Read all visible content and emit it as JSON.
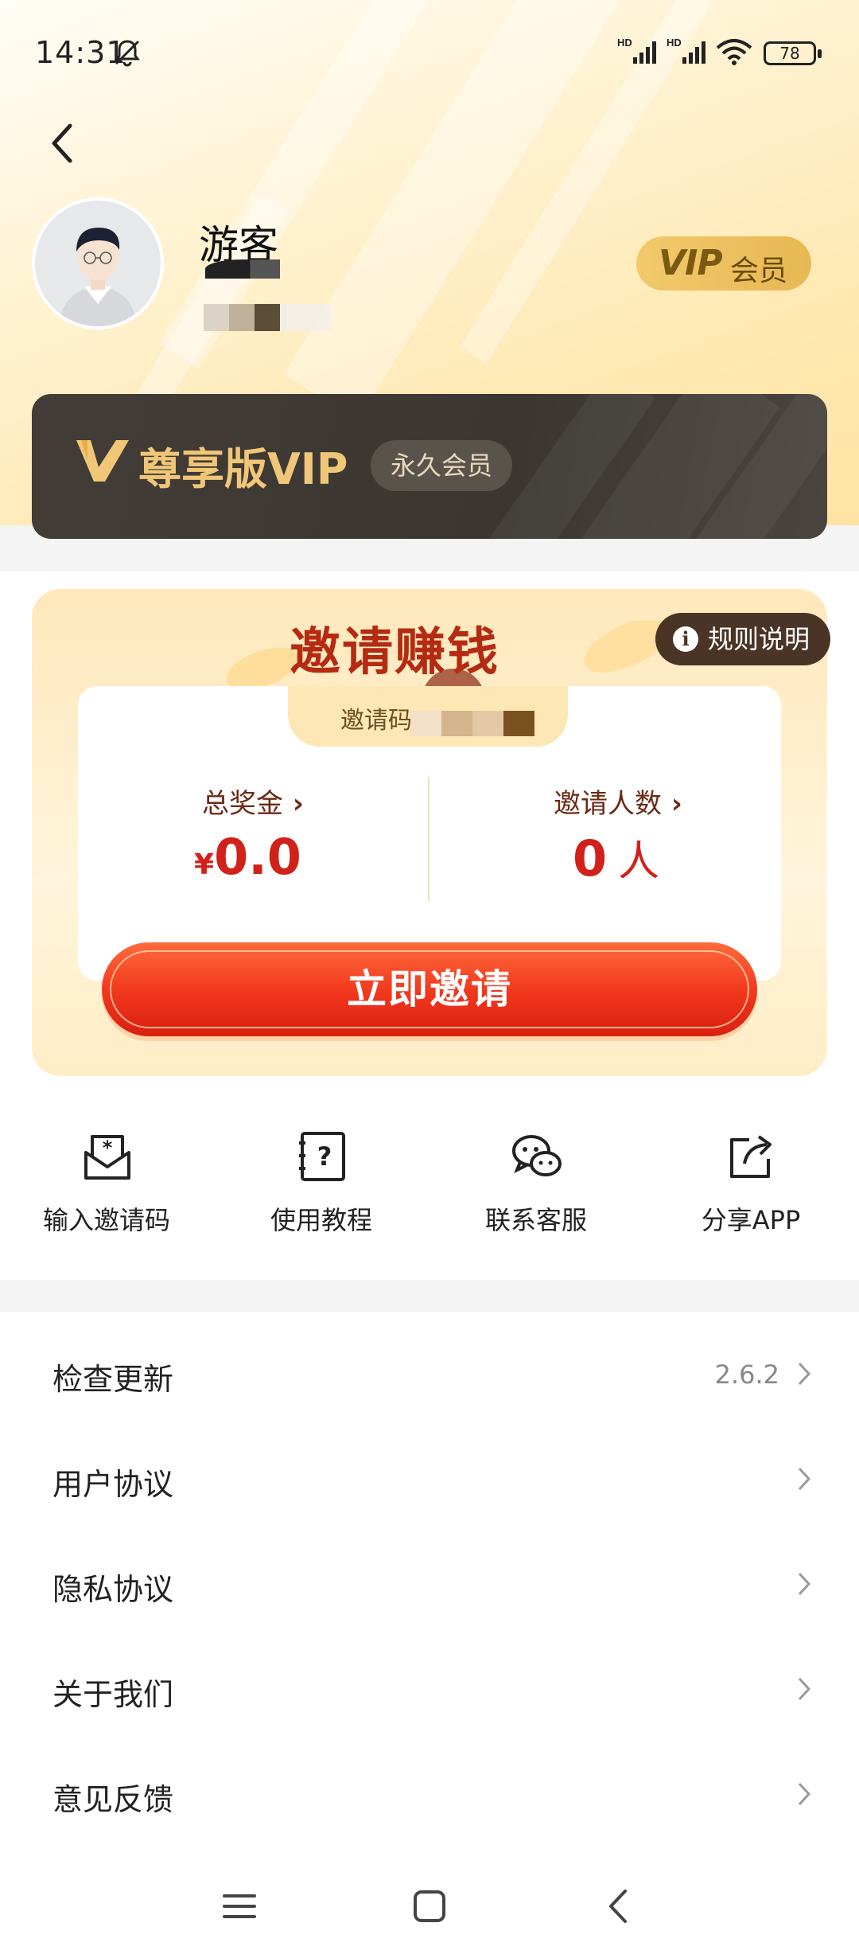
{
  "status_bar": {
    "time": "14:31",
    "signal1": "HD",
    "signal2": "HD",
    "battery": "78"
  },
  "profile": {
    "username": "游客",
    "vip_badge_logo": "VIP",
    "vip_badge_text": "会员"
  },
  "vip_card": {
    "title": "尊享版VIP",
    "pill": "永久会员"
  },
  "invite": {
    "title": "邀请赚钱",
    "rules_label": "规则说明",
    "code_label": "邀请码",
    "total_bonus_label": "总奖金",
    "currency": "¥",
    "total_bonus_value": "0.0",
    "invitee_label": "邀请人数",
    "invitee_value": "0",
    "invitee_unit": "人",
    "button_label": "立即邀请"
  },
  "quick_actions": [
    {
      "label": "输入邀请码",
      "icon": "mail-star-icon"
    },
    {
      "label": "使用教程",
      "icon": "question-book-icon"
    },
    {
      "label": "联系客服",
      "icon": "wechat-icon"
    },
    {
      "label": "分享APP",
      "icon": "share-icon"
    }
  ],
  "menu": [
    {
      "label": "检查更新",
      "value": "2.6.2"
    },
    {
      "label": "用户协议",
      "value": ""
    },
    {
      "label": "隐私协议",
      "value": ""
    },
    {
      "label": "关于我们",
      "value": ""
    },
    {
      "label": "意见反馈",
      "value": ""
    }
  ],
  "colors": {
    "accent_red": "#d2201a",
    "gold": "#f0c778",
    "dark_card": "#3f3a35"
  }
}
